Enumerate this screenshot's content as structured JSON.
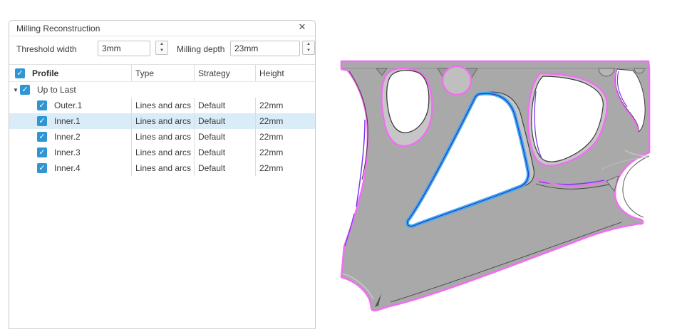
{
  "panel": {
    "title": "Milling Reconstruction",
    "icons": {
      "close": "✕",
      "check": "✓",
      "expander": "▼",
      "spin_up": "▲",
      "spin_down": "▼"
    },
    "controls": {
      "threshold_label": "Threshold width",
      "threshold_value": "3mm",
      "depth_label": "Milling depth",
      "depth_value": "23mm"
    },
    "table": {
      "columns": {
        "profile": "Profile",
        "type": "Type",
        "strategy": "Strategy",
        "height": "Height"
      },
      "group": {
        "label": "Up to Last",
        "checked": true,
        "expanded": true
      },
      "rows": [
        {
          "name": "Outer.1",
          "type": "Lines and arcs",
          "strategy": "Default",
          "height": "22mm",
          "checked": true,
          "selected": false
        },
        {
          "name": "Inner.1",
          "type": "Lines and arcs",
          "strategy": "Default",
          "height": "22mm",
          "checked": true,
          "selected": true
        },
        {
          "name": "Inner.2",
          "type": "Lines and arcs",
          "strategy": "Default",
          "height": "22mm",
          "checked": true,
          "selected": false
        },
        {
          "name": "Inner.3",
          "type": "Lines and arcs",
          "strategy": "Default",
          "height": "22mm",
          "checked": true,
          "selected": false
        },
        {
          "name": "Inner.4",
          "type": "Lines and arcs",
          "strategy": "Default",
          "height": "22mm",
          "checked": true,
          "selected": false
        }
      ]
    }
  },
  "viewport": {
    "selected_profile": "Inner.1",
    "colors": {
      "body_gray": "#a9a9a9",
      "milled_floor": "#c6c6c6",
      "profile_outline_magenta": "#f06ef2",
      "selected_profile_blue": "#45abee",
      "selected_inner_navy": "#2438c8",
      "secondary_outline_purple": "#7a36f2",
      "top_edge_dark": "#3c3c3c"
    }
  }
}
